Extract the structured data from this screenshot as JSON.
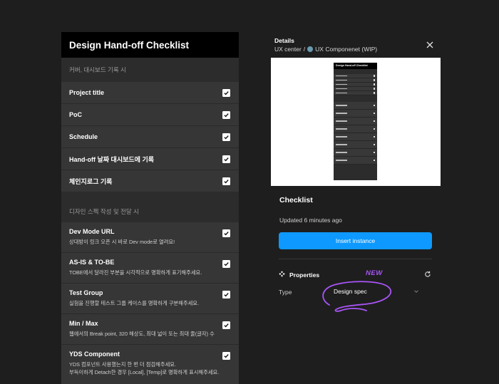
{
  "checklist": {
    "title": "Design Hand-off Checklist",
    "section1": "커버, 대시보드 기록 시",
    "items1": [
      {
        "label": "Project title",
        "checked": true
      },
      {
        "label": "PoC",
        "checked": true
      },
      {
        "label": "Schedule",
        "checked": true
      },
      {
        "label": "Hand-off 날짜 대시보드에 기록",
        "checked": true
      },
      {
        "label": "체인지로그 기록",
        "checked": true
      }
    ],
    "section2": "디자인 스펙 작성 및 전달 시",
    "items2": [
      {
        "label": "Dev Mode URL",
        "desc": "상대방이 링크 오픈 시 바로 Dev mode로 열려요!",
        "checked": true
      },
      {
        "label": "AS-IS & TO-BE",
        "desc": "TOBE에서 달라진 부분을 시각적으로 명확하게 표기해주세요.",
        "checked": true
      },
      {
        "label": "Test Group",
        "desc": "실험을 진행할 테스트 그룹 케이스를 명확하게 구분해주세요.",
        "checked": true
      },
      {
        "label": "Min / Max",
        "desc": "웹에서의 Break point, 320 해상도, 최대 넓이 또는 최대 줄(글자) 수",
        "checked": true
      },
      {
        "label": "YDS Component",
        "desc": "YDS 컴포넌트 사용했는지 한 번 더 점검해주세요.",
        "desc2": "부득이하게 Detach한 경우 [Local], [Temp]로 명확하게 표시해주세요.",
        "checked": true
      }
    ]
  },
  "details": {
    "title": "Details",
    "crumb_root": "UX center",
    "crumb_sep": "/",
    "crumb_page": "UX Componenet (WIP)",
    "preview_title": "Design Hand-off Checklist",
    "component_title": "Checklist",
    "updated": "Updated 6 minutes ago",
    "insert_label": "Insert instance",
    "properties_title": "Properties",
    "annotation": "NEW",
    "type_label": "Type",
    "type_value": "Design spec"
  },
  "colors": {
    "accent": "#0d99ff",
    "annotation": "#a855f7",
    "background": "#1e1e1e",
    "panel": "#2c2c2c"
  },
  "icons": [
    "check-icon",
    "close-icon",
    "properties-icon",
    "refresh-icon",
    "chevron-down-icon"
  ]
}
